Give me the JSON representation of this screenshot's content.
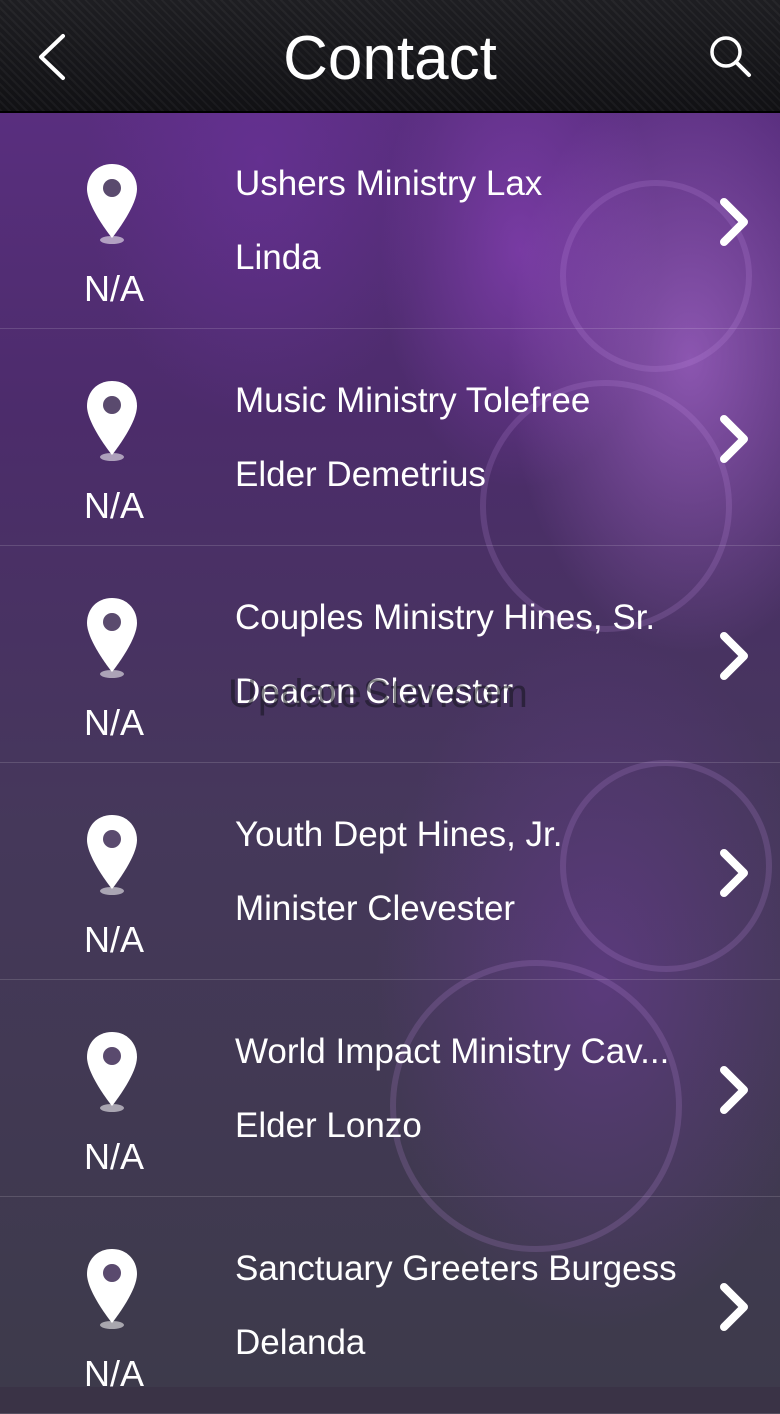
{
  "header": {
    "title": "Contact",
    "back_icon": "chevron-left-icon",
    "search_icon": "search-icon"
  },
  "contacts": [
    {
      "line1": "Ushers Ministry Lax",
      "line2": "Linda",
      "location": "N/A"
    },
    {
      "line1": "Music Ministry Tolefree",
      "line2": "Elder Demetrius",
      "location": "N/A"
    },
    {
      "line1": "Couples Ministry Hines, Sr.",
      "line2": "Deacon Clevester",
      "location": "N/A"
    },
    {
      "line1": "Youth Dept Hines, Jr.",
      "line2": "Minister Clevester",
      "location": "N/A"
    },
    {
      "line1": "World Impact Ministry Cav...",
      "line2": "Elder Lonzo",
      "location": "N/A"
    },
    {
      "line1": "Sanctuary Greeters Burgess",
      "line2": "Delanda",
      "location": "N/A"
    }
  ],
  "watermark": "UpdateStar.com",
  "colors": {
    "header_bg": "#141417",
    "text": "#ffffff",
    "accent_purple": "#5e2f86"
  }
}
